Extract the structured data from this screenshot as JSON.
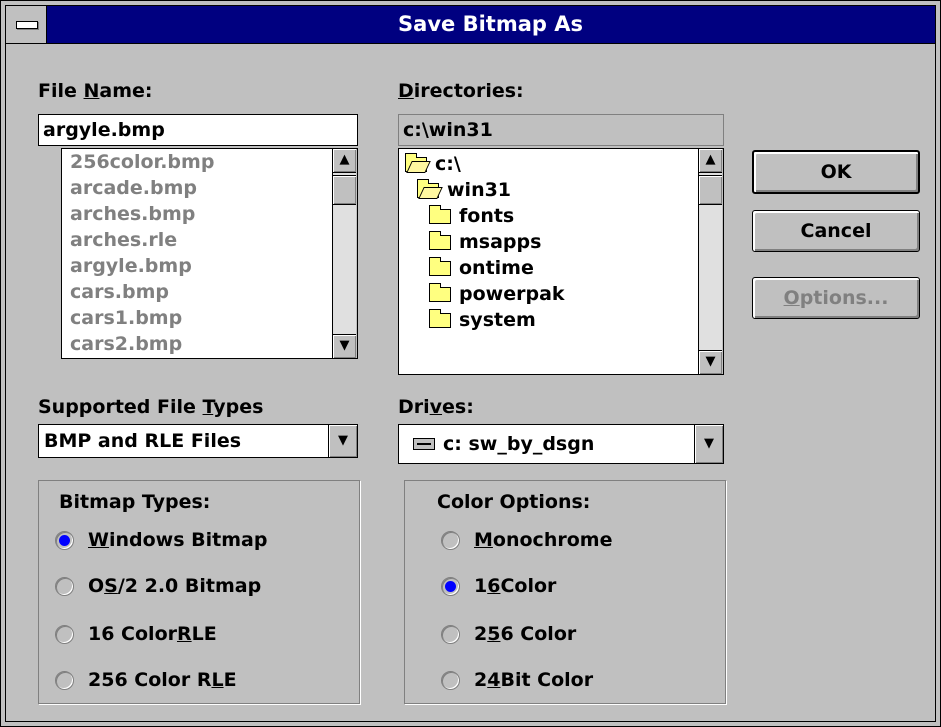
{
  "window": {
    "title": "Save Bitmap As"
  },
  "file_name": {
    "label_pre": "File ",
    "label_u": "N",
    "label_post": "ame:",
    "value": "argyle.bmp",
    "files": [
      "256color.bmp",
      "arcade.bmp",
      "arches.bmp",
      "arches.rle",
      "argyle.bmp",
      "cars.bmp",
      "cars1.bmp",
      "cars2.bmp"
    ]
  },
  "directories": {
    "label_u": "D",
    "label_post": "irectories:",
    "current": "c:\\win31",
    "items": [
      "c:\\",
      "win31",
      "fonts",
      "msapps",
      "ontime",
      "powerpak",
      "system"
    ]
  },
  "buttons": {
    "ok": "OK",
    "cancel": "Cancel",
    "options_u": "O",
    "options_post": "ptions..."
  },
  "file_types": {
    "label_pre": "Supported File ",
    "label_u": "T",
    "label_post": "ypes",
    "selected": "BMP and RLE Files"
  },
  "drives": {
    "label_pre": "Dri",
    "label_u": "v",
    "label_post": "es:",
    "selected": "c: sw_by_dsgn"
  },
  "bitmap_types": {
    "label": "Bitmap Types:",
    "options": [
      {
        "pre": "",
        "u": "W",
        "post": "indows Bitmap",
        "checked": true
      },
      {
        "pre": "O",
        "u": "S",
        "post": "/2 2.0 Bitmap",
        "checked": false
      },
      {
        "pre": "16 Color ",
        "u": "R",
        "post": "LE",
        "checked": false
      },
      {
        "pre": "256 Color R",
        "u": "L",
        "post": "E",
        "checked": false
      }
    ]
  },
  "color_options": {
    "label": "Color Options:",
    "options": [
      {
        "pre": "",
        "u": "M",
        "post": "onochrome",
        "checked": false
      },
      {
        "pre": "1",
        "u": "6",
        "post": " Color",
        "checked": true
      },
      {
        "pre": "2",
        "u": "5",
        "post": "6 Color",
        "checked": false
      },
      {
        "pre": "2",
        "u": "4",
        "post": " Bit Color",
        "checked": false
      }
    ]
  },
  "icons": {
    "scroll_up": "up-arrow-icon",
    "scroll_down": "down-arrow-icon",
    "dropdown": "dropdown-arrow-icon",
    "folder": "folder-icon",
    "drive": "hard-drive-icon"
  },
  "colors": {
    "titlebar": "#000080",
    "face": "#c0c0c0",
    "radio_on": "#0000ff",
    "disabled_text": "#808080"
  }
}
